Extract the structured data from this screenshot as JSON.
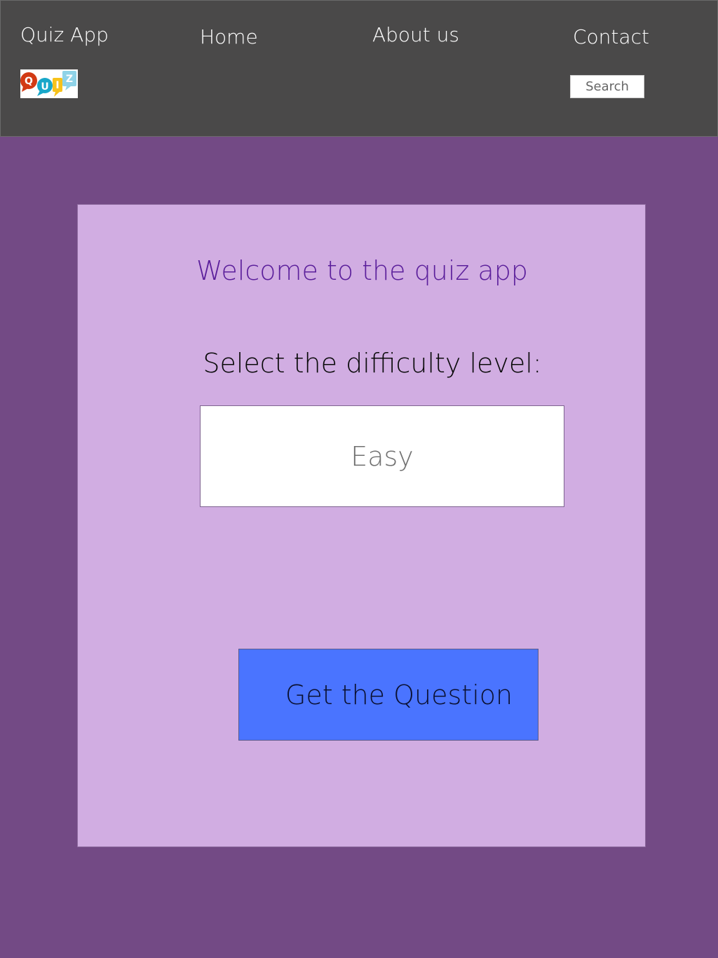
{
  "header": {
    "app_title": "Quiz App",
    "logo_letters": [
      "Q",
      "U",
      "I",
      "Z"
    ],
    "nav": {
      "home": "Home",
      "about": "About us",
      "contact": "Contact"
    },
    "search": {
      "placeholder": "Search",
      "value": ""
    }
  },
  "main": {
    "welcome": "Welcome to the quiz app",
    "select_label": "Select the difficulty level:",
    "difficulty_selected": "Easy",
    "get_question_label": "Get the Question"
  },
  "colors": {
    "header_bg": "#4a4949",
    "page_bg": "#734a85",
    "card_bg": "#d1ade2",
    "welcome_text": "#5b1f9b",
    "button_bg": "#4a74ff"
  }
}
